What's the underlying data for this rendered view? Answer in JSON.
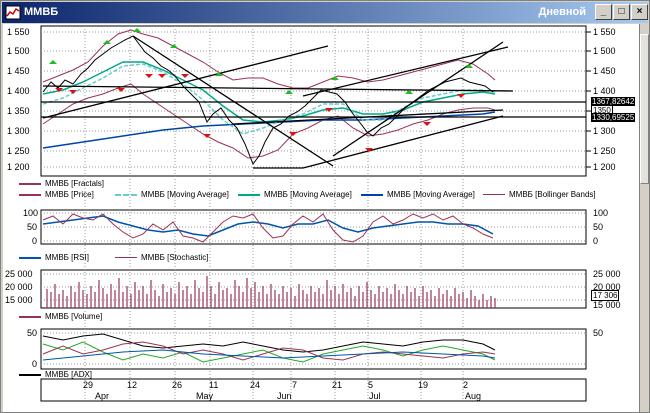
{
  "window": {
    "title": "ММВБ",
    "timeframe": "Дневной",
    "min_glyph": "_",
    "max_glyph": "□",
    "close_glyph": "×"
  },
  "colors": {
    "price": "#000000",
    "ma_short": "#66cccc",
    "ma_mid": "#00aa88",
    "ma_long": "#0044aa",
    "bollinger": "#993355",
    "fractal_up": "#22bb22",
    "fractal_down": "#dd1111",
    "volume": "#993355",
    "rsi": "#0055aa",
    "stochastic": "#993355",
    "adx": "#000000"
  },
  "price_panel": {
    "y_ticks": [
      "1 550",
      "1 500",
      "1 450",
      "1 400",
      "1 350",
      "1 300",
      "1 250",
      "1 200"
    ],
    "value_labels": [
      "1367,82642",
      "1350",
      "1330,69525"
    ],
    "legend": [
      "ММВБ [Fractals]",
      "ММВБ [Price]",
      "ММВБ [Moving Average]",
      "ММВБ [Moving Average]",
      "ММВБ [Moving Average]",
      "ММВБ [Bollinger Bands]"
    ]
  },
  "oscillator_panel": {
    "y_ticks": [
      "100",
      "50",
      "0"
    ],
    "legend": [
      "ММВБ [RSI]",
      "ММВБ [Stochastic]"
    ]
  },
  "volume_panel": {
    "y_ticks": [
      "25 000",
      "20 000",
      "15 000"
    ],
    "right_ticks": [
      "25 000",
      "20 000",
      "15 000"
    ],
    "current_value": "17 306",
    "legend": [
      "ММВБ [Volume]"
    ]
  },
  "adx_panel": {
    "y_ticks": [
      "50",
      "0"
    ],
    "legend": [
      "ММВБ [ADX]"
    ]
  },
  "x_axis": {
    "days": [
      "29",
      "12",
      "26",
      "11",
      "24",
      "7",
      "21",
      "5",
      "19",
      "2"
    ],
    "months": [
      "Apr",
      "May",
      "Jun",
      "Jul",
      "Aug"
    ]
  }
}
